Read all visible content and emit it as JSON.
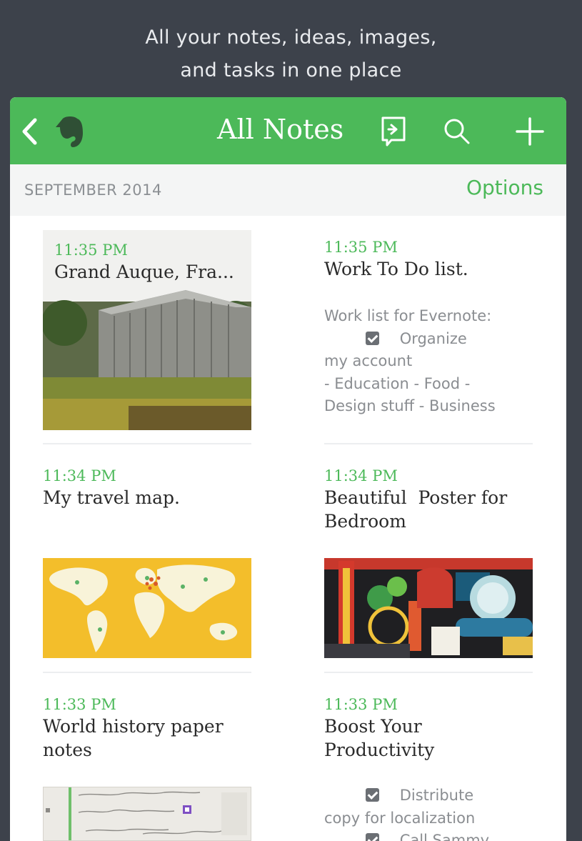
{
  "tagline": {
    "line1": "All your notes, ideas, images,",
    "line2": "and tasks in one place"
  },
  "navbar": {
    "title": "All Notes",
    "icons": [
      "back-chevron-icon",
      "evernote-elephant-icon",
      "work-chat-icon",
      "search-icon",
      "add-icon"
    ],
    "color": "#4cb959"
  },
  "section": {
    "date": "SEPTEMBER 2014",
    "options_label": "Options"
  },
  "notes": [
    {
      "time": "11:35 PM",
      "title": "Grand Auque, Fra...",
      "thumbnail": "barn-photo"
    },
    {
      "time": "11:35 PM",
      "title": "Work To Do list.",
      "body": {
        "line1": "Work list for Evernote:",
        "line2": "Organize",
        "line3": "my account",
        "line4": "- Education - Food -",
        "line5": "Design stuff - Business"
      }
    },
    {
      "time": "11:34 PM",
      "title": "My travel map.",
      "thumbnail": "world-map"
    },
    {
      "time": "11:34 PM",
      "title_line1": "Beautiful  Poster for",
      "title_line2": "Bedroom",
      "thumbnail": "london-poster"
    },
    {
      "time": "11:33 PM",
      "title_line1": "World history paper",
      "title_line2": "notes",
      "thumbnail": "handwritten-notes"
    },
    {
      "time": "11:33 PM",
      "title_line1": "Boost Your",
      "title_line2": "Productivity",
      "body": {
        "line1": "Distribute",
        "line2": "copy for localization",
        "line3": "Call Sammy"
      }
    }
  ]
}
